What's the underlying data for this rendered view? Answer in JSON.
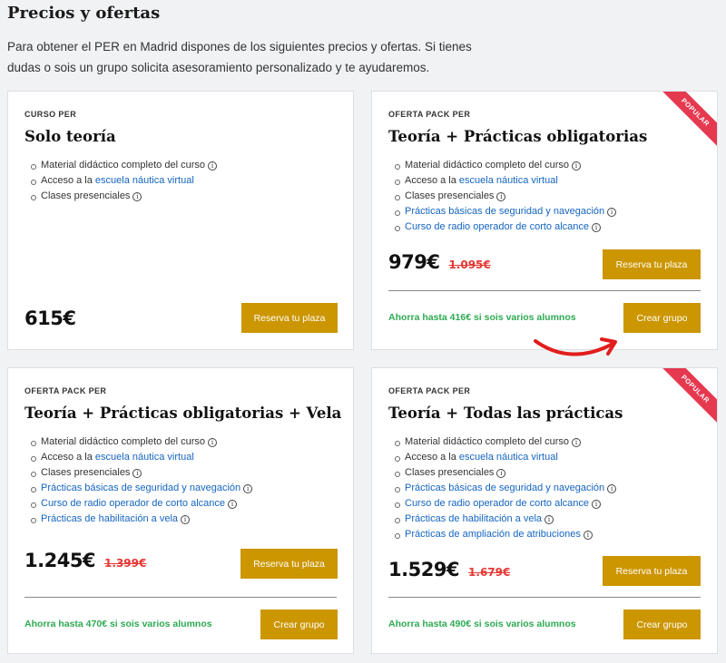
{
  "title": "Precios y ofertas",
  "intro": "Para obtener el PER en Madrid dispones de los siguientes precios y ofertas. Si tienes dudas o sois un grupo solicita asesoramiento personalizado y te ayudaremos.",
  "colors": {
    "accent": "#cc9600",
    "savings": "#2eaa52",
    "old_price": "#e53935",
    "link": "#1565c0",
    "ribbon": "#e53950"
  },
  "cards": [
    {
      "eyebrow": "CURSO PER",
      "title": "Solo teoría",
      "features": [
        {
          "prefix": "Material didáctico completo del curso",
          "link": "",
          "info": true
        },
        {
          "prefix": "Acceso a la ",
          "link": "escuela náutica virtual",
          "info": false
        },
        {
          "prefix": "Clases presenciales",
          "link": "",
          "info": true
        }
      ],
      "price": "615€",
      "old_price": "",
      "reserve": "Reserva tu plaza"
    },
    {
      "eyebrow": "OFERTA PACK PER",
      "title": "Teoría + Prácticas obligatorias",
      "ribbon": "POPULAR",
      "features": [
        {
          "prefix": "Material didáctico completo del curso",
          "link": "",
          "info": true
        },
        {
          "prefix": "Acceso a la ",
          "link": "escuela náutica virtual",
          "info": false
        },
        {
          "prefix": "Clases presenciales",
          "link": "",
          "info": true
        },
        {
          "prefix": "",
          "link": "Prácticas básicas de seguridad y navegación",
          "info": true
        },
        {
          "prefix": "",
          "link": "Curso de radio operador de corto alcance",
          "info": true
        }
      ],
      "price": "979€",
      "old_price": "1.095€",
      "reserve": "Reserva tu plaza",
      "savings": "Ahorra hasta 416€ si sois varios alumnos",
      "group": "Crear grupo"
    },
    {
      "eyebrow": "OFERTA PACK PER",
      "title": "Teoría + Prácticas obligatorias + Vela",
      "features": [
        {
          "prefix": "Material didáctico completo del curso",
          "link": "",
          "info": true
        },
        {
          "prefix": "Acceso a la ",
          "link": "escuela náutica virtual",
          "info": false
        },
        {
          "prefix": "Clases presenciales",
          "link": "",
          "info": true
        },
        {
          "prefix": "",
          "link": "Prácticas básicas de seguridad y navegación",
          "info": true
        },
        {
          "prefix": "",
          "link": "Curso de radio operador de corto alcance",
          "info": true
        },
        {
          "prefix": "",
          "link": "Prácticas de habilitación a vela",
          "info": true
        }
      ],
      "price": "1.245€",
      "old_price": "1.399€",
      "reserve": "Reserva tu plaza",
      "savings": "Ahorra hasta 470€ si sois varios alumnos",
      "group": "Crear grupo"
    },
    {
      "eyebrow": "OFERTA PACK PER",
      "title": "Teoría + Todas las prácticas",
      "ribbon": "POPULAR",
      "features": [
        {
          "prefix": "Material didáctico completo del curso",
          "link": "",
          "info": true
        },
        {
          "prefix": "Acceso a la ",
          "link": "escuela náutica virtual",
          "info": false
        },
        {
          "prefix": "Clases presenciales",
          "link": "",
          "info": true
        },
        {
          "prefix": "",
          "link": "Prácticas básicas de seguridad y navegación",
          "info": true
        },
        {
          "prefix": "",
          "link": "Curso de radio operador de corto alcance",
          "info": true
        },
        {
          "prefix": "",
          "link": "Prácticas de habilitación a vela",
          "info": true
        },
        {
          "prefix": "",
          "link": "Prácticas de ampliación de atribuciones",
          "info": true
        }
      ],
      "price": "1.529€",
      "old_price": "1.679€",
      "reserve": "Reserva tu plaza",
      "savings": "Ahorra hasta 490€ si sois varios alumnos",
      "group": "Crear grupo"
    }
  ]
}
